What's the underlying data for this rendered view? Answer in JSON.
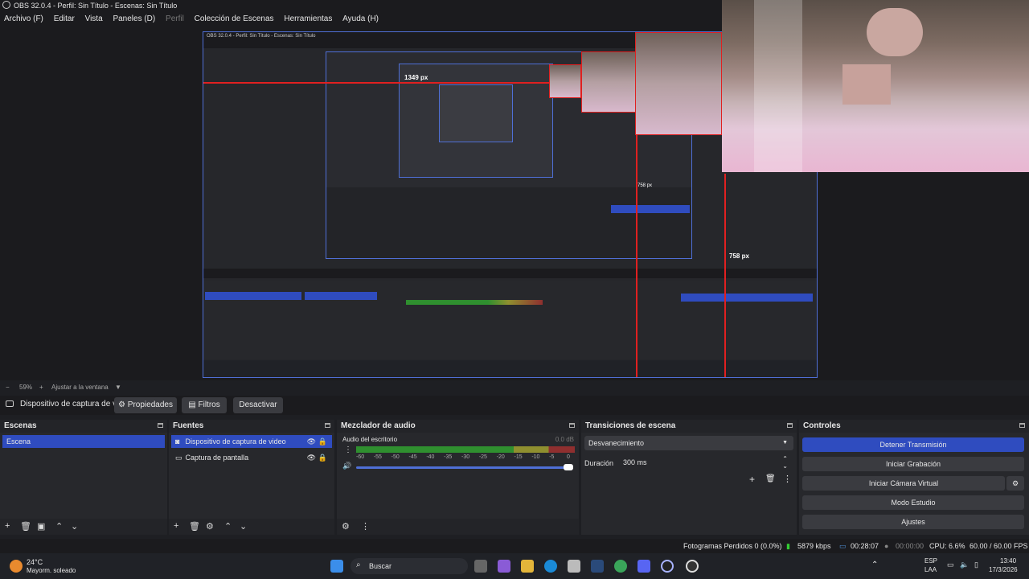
{
  "window": {
    "title": "OBS 32.0.4 - Perfil: Sin Título - Escenas: Sin Título"
  },
  "menu": {
    "items": [
      "Archivo (F)",
      "Editar",
      "Vista",
      "Paneles (D)",
      "Perfil",
      "Colección de Escenas",
      "Herramientas",
      "Ayuda (H)"
    ]
  },
  "preview": {
    "nested_title": "OBS 32.0.4 - Perfil: Sin Título - Escenas: Sin Título",
    "measure_width": "1349 px",
    "measure_height": "758 px",
    "inner_measure": "758 px"
  },
  "zoom": {
    "minus": "−",
    "value": "59%",
    "plus": "+",
    "fit_label": "Ajustar a la ventana"
  },
  "source_toolbar": {
    "source_name": "Dispositivo de captura de v",
    "properties": "Propiedades",
    "filters": "Filtros",
    "deactivate": "Desactivar"
  },
  "scenes": {
    "title": "Escenas",
    "items": [
      "Escena"
    ]
  },
  "sources": {
    "title": "Fuentes",
    "items": [
      "Dispositivo de captura de video",
      "Captura de pantalla"
    ]
  },
  "mixer": {
    "title": "Mezclador de audio",
    "channel": "Audio del escritorio",
    "level": "0.0 dB",
    "ticks": [
      "-60",
      "-55",
      "-50",
      "-45",
      "-40",
      "-35",
      "-30",
      "-25",
      "-20",
      "-15",
      "-10",
      "-5",
      "0"
    ]
  },
  "transitions": {
    "title": "Transiciones de escena",
    "selected": "Desvanecimiento",
    "duration_label": "Duración",
    "duration_value": "300 ms"
  },
  "controls": {
    "title": "Controles",
    "stop_stream": "Detener Transmisión",
    "start_recording": "Iniciar Grabación",
    "start_virtualcam": "Iniciar Cámara Virtual",
    "studio_mode": "Modo Estudio",
    "settings": "Ajustes"
  },
  "status": {
    "dropped_frames": "Fotogramas Perdidos 0 (0.0%)",
    "bitrate": "5879 kbps",
    "stream_time": "00:28:07",
    "record_time": "00:00:00",
    "cpu": "CPU: 6.6%",
    "fps": "60.00 / 60.00 FPS"
  },
  "taskbar": {
    "weather_temp": "24°C",
    "weather_desc": "Mayorm. soleado",
    "search_placeholder": "Buscar",
    "lang_top": "ESP",
    "lang_bottom": "LAA",
    "time": "13:40",
    "date": "17/3/2026"
  },
  "colors": {
    "accent": "#2f4cbf",
    "meter_green": "#2f8f2f",
    "meter_yellow": "#8f8f2f",
    "meter_red": "#8f2f2f",
    "guide_red": "#e02020"
  }
}
